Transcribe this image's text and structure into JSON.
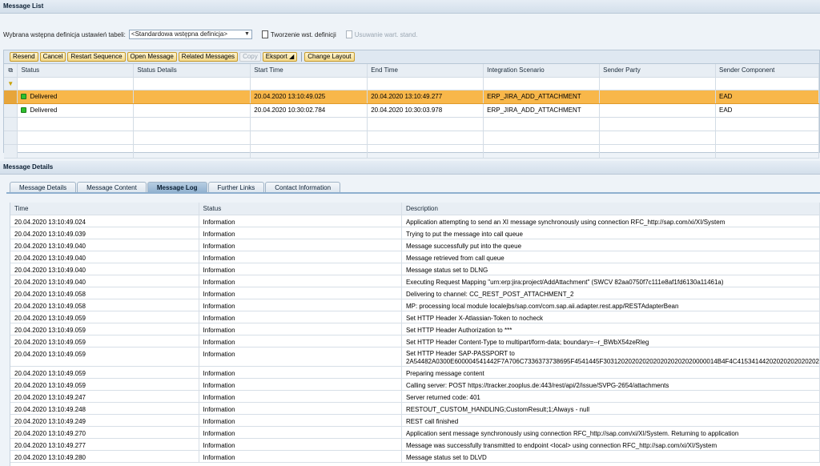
{
  "message_list": {
    "title": "Message List",
    "variant_label": "Wybrana wstępna definicja ustawień tabeli:",
    "variant_value": "<Standardowa wstępna definicja>",
    "create_variant": "Tworzenie wst. definicji",
    "remove_values": "Usuwanie wart. stand.",
    "toolbar": {
      "resend": "Resend",
      "cancel": "Cancel",
      "restart": "Restart Sequence",
      "open": "Open Message",
      "related": "Related Messages",
      "copy": "Copy",
      "export": "Eksport",
      "change_layout": "Change Layout"
    },
    "columns": [
      "Status",
      "Status Details",
      "Start Time",
      "End Time",
      "Integration Scenario",
      "Sender Party",
      "Sender Component"
    ],
    "rows": [
      {
        "status": "Delivered",
        "details": "",
        "start": "20.04.2020 13:10:49.025",
        "end": "20.04.2020 13:10:49.277",
        "scenario": "ERP_JIRA_ADD_ATTACHMENT",
        "party": "",
        "component": "EAD"
      },
      {
        "status": "Delivered",
        "details": "",
        "start": "20.04.2020 10:30:02.784",
        "end": "20.04.2020 10:30:03.978",
        "scenario": "ERP_JIRA_ADD_ATTACHMENT",
        "party": "",
        "component": "EAD"
      }
    ]
  },
  "message_details": {
    "title": "Message Details",
    "tabs": [
      "Message Details",
      "Message Content",
      "Message Log",
      "Further Links",
      "Contact Information"
    ],
    "active_tab": "Message Log",
    "log_columns": [
      "Time",
      "Status",
      "Description"
    ],
    "log": [
      {
        "time": "20.04.2020 13:10:49.024",
        "status": "Information",
        "desc": "Application attempting to send an XI message synchronously using connection RFC_http://sap.com/xi/XI/System"
      },
      {
        "time": "20.04.2020 13:10:49.039",
        "status": "Information",
        "desc": "Trying to put the message into call queue"
      },
      {
        "time": "20.04.2020 13:10:49.040",
        "status": "Information",
        "desc": "Message successfully put into the queue"
      },
      {
        "time": "20.04.2020 13:10:49.040",
        "status": "Information",
        "desc": "Message retrieved from call queue"
      },
      {
        "time": "20.04.2020 13:10:49.040",
        "status": "Information",
        "desc": "Message status set to DLNG"
      },
      {
        "time": "20.04.2020 13:10:49.040",
        "status": "Information",
        "desc": "Executing Request Mapping \"urn:erp:jira:project/AddAttachment\" (SWCV 82aa0750f7c111e8af1fd6130a11461a)"
      },
      {
        "time": "20.04.2020 13:10:49.058",
        "status": "Information",
        "desc": "Delivering to channel: CC_REST_POST_ATTACHMENT_2"
      },
      {
        "time": "20.04.2020 13:10:49.058",
        "status": "Information",
        "desc": "MP: processing local module localejbs/sap.com/com.sap.aii.adapter.rest.app/RESTAdapterBean"
      },
      {
        "time": "20.04.2020 13:10:49.059",
        "status": "Information",
        "desc": "Set HTTP Header X-Atlassian-Token to nocheck"
      },
      {
        "time": "20.04.2020 13:10:49.059",
        "status": "Information",
        "desc": "Set HTTP Header Authorization to ***"
      },
      {
        "time": "20.04.2020 13:10:49.059",
        "status": "Information",
        "desc": "Set HTTP Header Content-Type to multipart/form-data; boundary=--r_BWbX54zeRleg"
      },
      {
        "time": "20.04.2020 13:10:49.059",
        "status": "Information",
        "desc": "Set HTTP Header SAP-PASSPORT to 2A54482A0300E600004541442F7A706C7336373738695F4541445F30312020202020202020202020000014B4F4C41534144202020202020202"
      },
      {
        "time": "20.04.2020 13:10:49.059",
        "status": "Information",
        "desc": "Preparing message content"
      },
      {
        "time": "20.04.2020 13:10:49.059",
        "status": "Information",
        "desc": "Calling server: POST https://tracker.zooplus.de:443/rest/api/2/issue/SVPG-2654/attachments"
      },
      {
        "time": "20.04.2020 13:10:49.247",
        "status": "Information",
        "desc": "Server returned code: 401"
      },
      {
        "time": "20.04.2020 13:10:49.248",
        "status": "Information",
        "desc": "RESTOUT_CUSTOM_HANDLING;CustomResult;1;Always - null"
      },
      {
        "time": "20.04.2020 13:10:49.249",
        "status": "Information",
        "desc": "REST call finished"
      },
      {
        "time": "20.04.2020 13:10:49.270",
        "status": "Information",
        "desc": "Application sent message synchronously using connection RFC_http://sap.com/xi/XI/System. Returning to application"
      },
      {
        "time": "20.04.2020 13:10:49.277",
        "status": "Information",
        "desc": "Message was successfully transmitted to endpoint <local> using connection RFC_http://sap.com/xi/XI/System"
      },
      {
        "time": "20.04.2020 13:10:49.280",
        "status": "Information",
        "desc": "Message status set to DLVD"
      }
    ]
  }
}
